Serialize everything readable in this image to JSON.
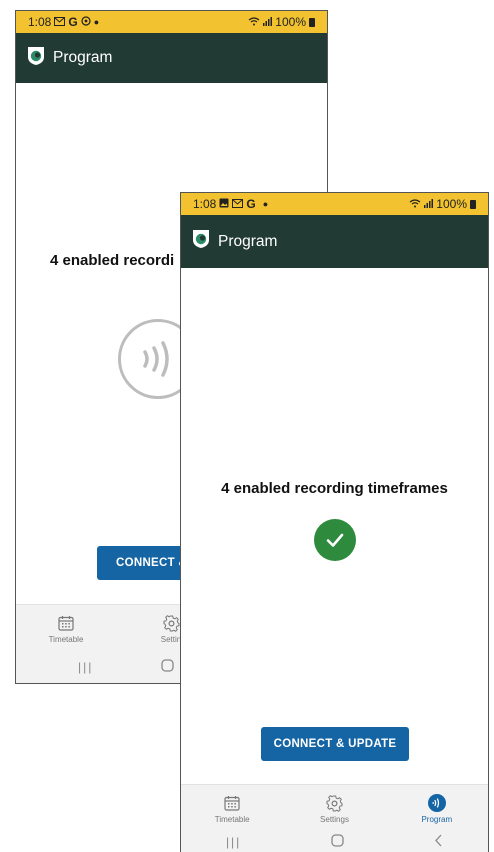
{
  "back_screen": {
    "status_bar": {
      "time": "1:08",
      "icons_left": [
        "mail-icon",
        "google-icon",
        "sync-icon",
        "dot-icon"
      ],
      "battery": "100%"
    },
    "app_bar": {
      "title": "Program"
    },
    "message": "4 enabled recordi",
    "primary_button": "CONNECT &",
    "nav": [
      {
        "label": "Timetable",
        "icon": "calendar-icon"
      },
      {
        "label": "Settin",
        "icon": "gear-icon"
      }
    ]
  },
  "front_screen": {
    "status_bar": {
      "time": "1:08",
      "icons_left": [
        "image-icon",
        "mail-icon",
        "google-icon",
        "dot-icon"
      ],
      "battery": "100%"
    },
    "app_bar": {
      "title": "Program"
    },
    "message": "4 enabled recording timeframes",
    "primary_button": "CONNECT & UPDATE",
    "nav": [
      {
        "label": "Timetable",
        "icon": "calendar-icon"
      },
      {
        "label": "Settings",
        "icon": "gear-icon"
      },
      {
        "label": "Program",
        "icon": "nfc-icon",
        "active": true
      }
    ]
  },
  "colors": {
    "status_bar": "#f2c230",
    "app_bar": "#213a33",
    "accent": "#1565a5",
    "success": "#2e8b3d"
  }
}
